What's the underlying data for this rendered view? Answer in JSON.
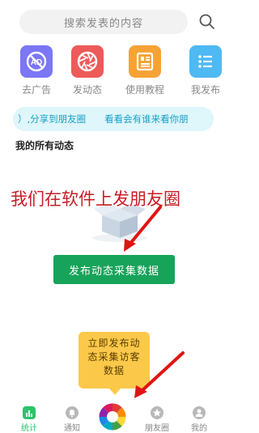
{
  "search": {
    "placeholder": "搜索发表的内容"
  },
  "shortcuts": [
    {
      "label": "去广告",
      "color": "#7b77f5",
      "icon": "ad-block-icon"
    },
    {
      "label": "发动态",
      "color": "#ee5a5a",
      "icon": "camera-shutter-icon"
    },
    {
      "label": "使用教程",
      "color": "#f7a234",
      "icon": "document-icon"
    },
    {
      "label": "我发布",
      "color": "#4fb9f3",
      "icon": "list-icon"
    }
  ],
  "ticker": {
    "text": "）,分享到朋友圈　　看看会有谁来看你朋"
  },
  "section": {
    "title": "我的所有动态"
  },
  "promo": {
    "text": "我们在软件上发朋友圈"
  },
  "collect_button": {
    "label": "发布动态采集数据"
  },
  "tooltip": {
    "text": "立即发布动态采集访客数据"
  },
  "tabbar": {
    "items": [
      {
        "label": "统计",
        "icon": "stats-icon",
        "active": true
      },
      {
        "label": "通知",
        "icon": "bell-icon",
        "active": false
      },
      {
        "label": "朋友圈",
        "icon": "star-icon",
        "active": false
      },
      {
        "label": "我的",
        "icon": "user-icon",
        "active": false
      }
    ]
  },
  "colors": {
    "accent": "#17a35a",
    "tab_active": "#2cc36b",
    "promo_red": "#c81d25",
    "tooltip": "#fbc84a",
    "ticker_text": "#1aa0c8"
  }
}
